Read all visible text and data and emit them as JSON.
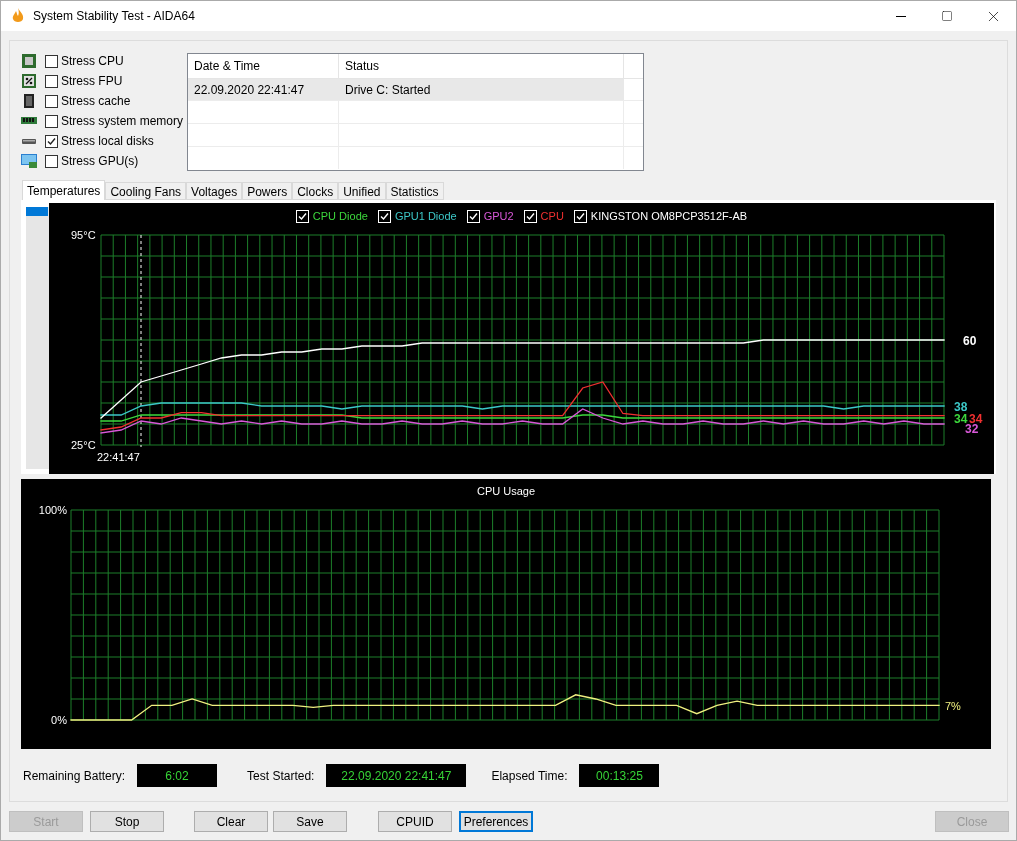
{
  "window": {
    "title": "System Stability Test - AIDA64"
  },
  "stress_options": [
    {
      "label": "Stress CPU",
      "checked": false,
      "kind": "cpu"
    },
    {
      "label": "Stress FPU",
      "checked": false,
      "kind": "fpu"
    },
    {
      "label": "Stress cache",
      "checked": false,
      "kind": "cache"
    },
    {
      "label": "Stress system memory",
      "checked": false,
      "kind": "memory"
    },
    {
      "label": "Stress local disks",
      "checked": true,
      "kind": "disk"
    },
    {
      "label": "Stress GPU(s)",
      "checked": false,
      "kind": "gpu"
    }
  ],
  "log": {
    "columns": [
      "Date & Time",
      "Status"
    ],
    "rows": [
      {
        "cells": [
          "22.09.2020 22:41:47",
          "Drive C: Started"
        ],
        "selected": true
      }
    ]
  },
  "tabs": [
    {
      "label": "Temperatures",
      "selected": true
    },
    {
      "label": "Cooling Fans",
      "selected": false
    },
    {
      "label": "Voltages",
      "selected": false
    },
    {
      "label": "Powers",
      "selected": false
    },
    {
      "label": "Clocks",
      "selected": false
    },
    {
      "label": "Unified",
      "selected": false
    },
    {
      "label": "Statistics",
      "selected": false
    }
  ],
  "temperature_chart": {
    "time": "22:41:47",
    "legend": [
      {
        "checked": true
      },
      {
        "checked": true
      },
      {
        "checked": true
      },
      {
        "checked": true
      },
      {
        "checked": true
      }
    ],
    "chart_data": {
      "type": "line",
      "grid": true,
      "ylim": [
        25,
        95
      ],
      "yticks": [
        {
          "value": 25,
          "label": "25°C"
        },
        {
          "value": 95,
          "label": "95°C"
        }
      ],
      "series": [
        {
          "name": "CPU Diode",
          "color": "#3cd83c",
          "values": [
            33,
            33,
            35,
            35,
            35,
            35,
            35,
            35,
            35,
            35,
            35,
            35,
            35,
            34,
            34,
            34,
            34,
            34,
            34,
            34,
            34,
            34,
            34,
            34,
            35,
            35,
            34,
            34,
            34,
            34,
            34,
            34,
            34,
            34,
            34,
            34,
            34,
            34,
            34,
            34,
            34,
            34,
            34
          ]
        },
        {
          "name": "GPU1 Diode",
          "color": "#3cc8c8",
          "values": [
            35,
            35,
            38,
            39,
            39,
            39,
            39,
            39,
            38,
            38,
            38,
            38,
            37,
            38,
            38,
            38,
            38,
            38,
            38,
            37,
            38,
            38,
            38,
            38,
            38,
            38,
            38,
            38,
            38,
            38,
            38,
            38,
            38,
            38,
            38,
            38,
            38,
            37,
            38,
            38,
            38,
            38,
            38
          ]
        },
        {
          "name": "GPU2",
          "color": "#d858d8",
          "values": [
            29,
            30,
            33,
            32,
            34,
            33,
            32,
            33,
            32,
            33,
            32,
            32,
            33,
            32,
            32,
            33,
            32,
            32,
            33,
            32,
            32,
            33,
            32,
            32,
            37,
            34,
            32,
            33,
            32,
            32,
            33,
            32,
            32,
            33,
            32,
            33,
            32,
            32,
            33,
            32,
            33,
            32,
            32
          ]
        },
        {
          "name": "CPU",
          "color": "#f03030",
          "values": [
            30,
            31,
            34,
            34,
            35.8,
            35.8,
            34.8,
            34.8,
            34.8,
            34.8,
            34.8,
            34.8,
            34.8,
            34.8,
            34.8,
            34.8,
            34.8,
            34.8,
            34.8,
            34.8,
            34.8,
            34.8,
            34.8,
            34.8,
            44,
            46,
            35.5,
            34.8,
            34.8,
            34.8,
            34.8,
            34.8,
            34.8,
            34.8,
            34.8,
            34.8,
            34.8,
            34.8,
            34.8,
            34.8,
            34.8,
            34.8,
            34.8
          ]
        },
        {
          "name": "KINGSTON OM8PCP3512F-AB",
          "color": "#ffffff",
          "values": [
            34,
            40,
            46,
            48,
            50,
            52,
            54,
            55,
            55,
            56,
            56,
            57,
            57,
            58,
            58,
            58,
            59,
            59,
            59,
            59,
            59,
            59,
            59,
            59,
            59,
            59,
            59,
            59,
            59,
            59,
            59,
            59,
            59,
            60,
            60,
            60,
            60,
            60,
            60,
            60,
            60,
            60,
            60
          ]
        }
      ]
    },
    "end_labels": [
      {
        "text": "60",
        "color": "#ffffff"
      },
      {
        "text": "38",
        "color": "#3cc8c8"
      },
      {
        "text": "34",
        "color": "#3cd83c"
      },
      {
        "text": "34",
        "color": "#f03030"
      },
      {
        "text": "32",
        "color": "#d858d8"
      }
    ]
  },
  "cpu_chart": {
    "end_label": "7%",
    "chart_data": {
      "type": "line",
      "grid": true,
      "title": "CPU Usage",
      "ylim": [
        0,
        100
      ],
      "yticks": [
        {
          "value": 0,
          "label": "0%"
        },
        {
          "value": 100,
          "label": "100%"
        }
      ],
      "series": [
        {
          "color": "#f0f080",
          "values": [
            0,
            0,
            0,
            0,
            7,
            7,
            10,
            7,
            7,
            7,
            7,
            7,
            6,
            7,
            7,
            7,
            7,
            7,
            7,
            7,
            7,
            7,
            7,
            7,
            7,
            12,
            10,
            7,
            7,
            7,
            7,
            3,
            7,
            9,
            7,
            7,
            7,
            7,
            7,
            7,
            7,
            7,
            7,
            7
          ]
        }
      ]
    }
  },
  "info": [
    {
      "label": "Remaining Battery:",
      "value": "6:02"
    },
    {
      "label": "Test Started:",
      "value": "22.09.2020 22:41:47"
    },
    {
      "label": "Elapsed Time:",
      "value": "00:13:25"
    }
  ],
  "buttons": [
    {
      "label": "Start",
      "disabled": true,
      "focused": false
    },
    {
      "label": "Stop",
      "disabled": false,
      "focused": false
    },
    {
      "label": "Clear",
      "disabled": false,
      "focused": false
    },
    {
      "label": "Save",
      "disabled": false,
      "focused": false
    },
    {
      "label": "CPUID",
      "disabled": false,
      "focused": false
    },
    {
      "label": "Preferences",
      "disabled": false,
      "focused": true
    },
    {
      "label": "Close",
      "disabled": true,
      "focused": false
    }
  ]
}
